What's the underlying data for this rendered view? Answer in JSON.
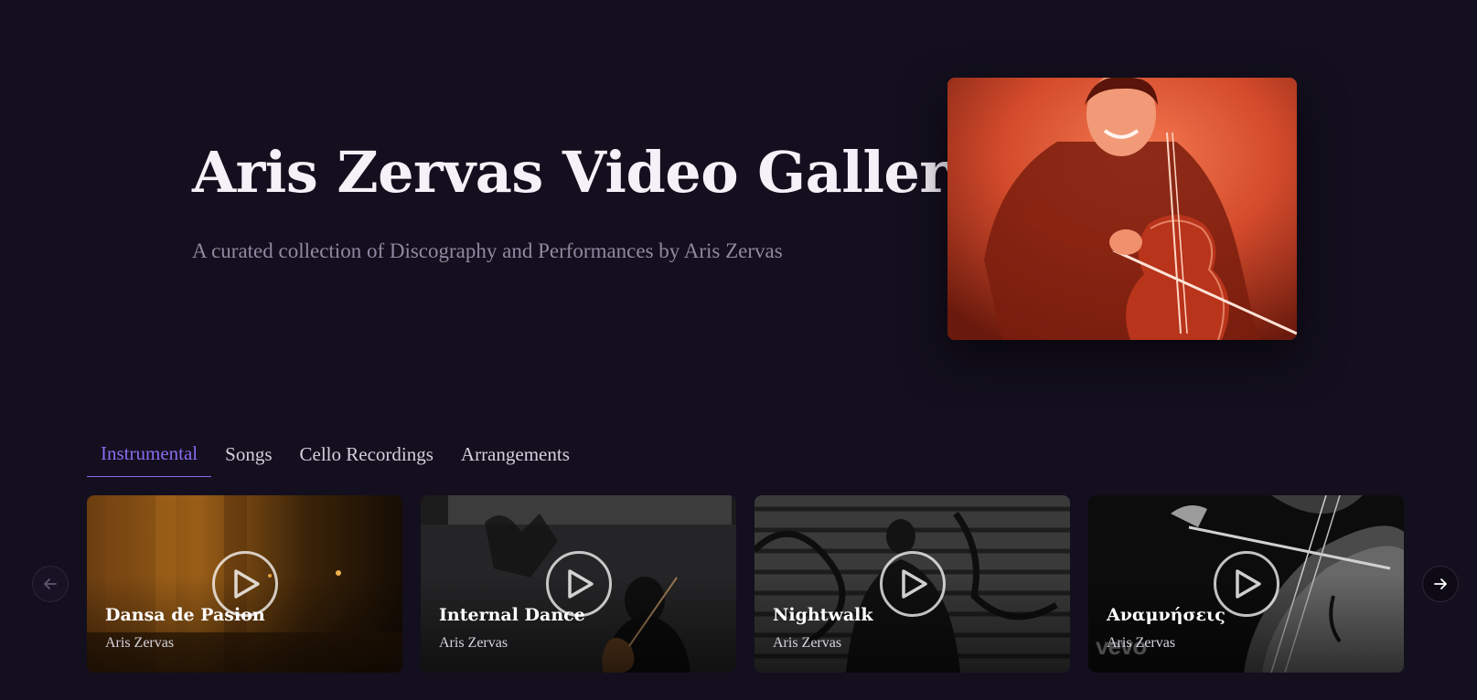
{
  "hero": {
    "title": "Aris Zervas Video Gallery",
    "subtitle": "A curated collection of Discography and Performances by Aris Zervas",
    "image_alt": "cellist-portrait"
  },
  "tabs": [
    {
      "label": "Instrumental",
      "active": true
    },
    {
      "label": "Songs",
      "active": false
    },
    {
      "label": "Cello Recordings",
      "active": false
    },
    {
      "label": "Arrangements",
      "active": false
    }
  ],
  "videos": [
    {
      "title": "Dansa de Pasion",
      "artist": "Aris Zervas"
    },
    {
      "title": "Internal Dance",
      "artist": "Aris Zervas"
    },
    {
      "title": "Nightwalk",
      "artist": "Aris Zervas"
    },
    {
      "title": "Αναμνήσεις",
      "artist": "Aris Zervas",
      "watermark": "vevo"
    }
  ],
  "carousel": {
    "prev_icon": "arrow-left-icon",
    "next_icon": "arrow-right-icon"
  },
  "colors": {
    "background": "#130f1e",
    "accent": "#8b6cf0",
    "title": "#f4f1f8",
    "subtitle": "#8f8aa0"
  }
}
